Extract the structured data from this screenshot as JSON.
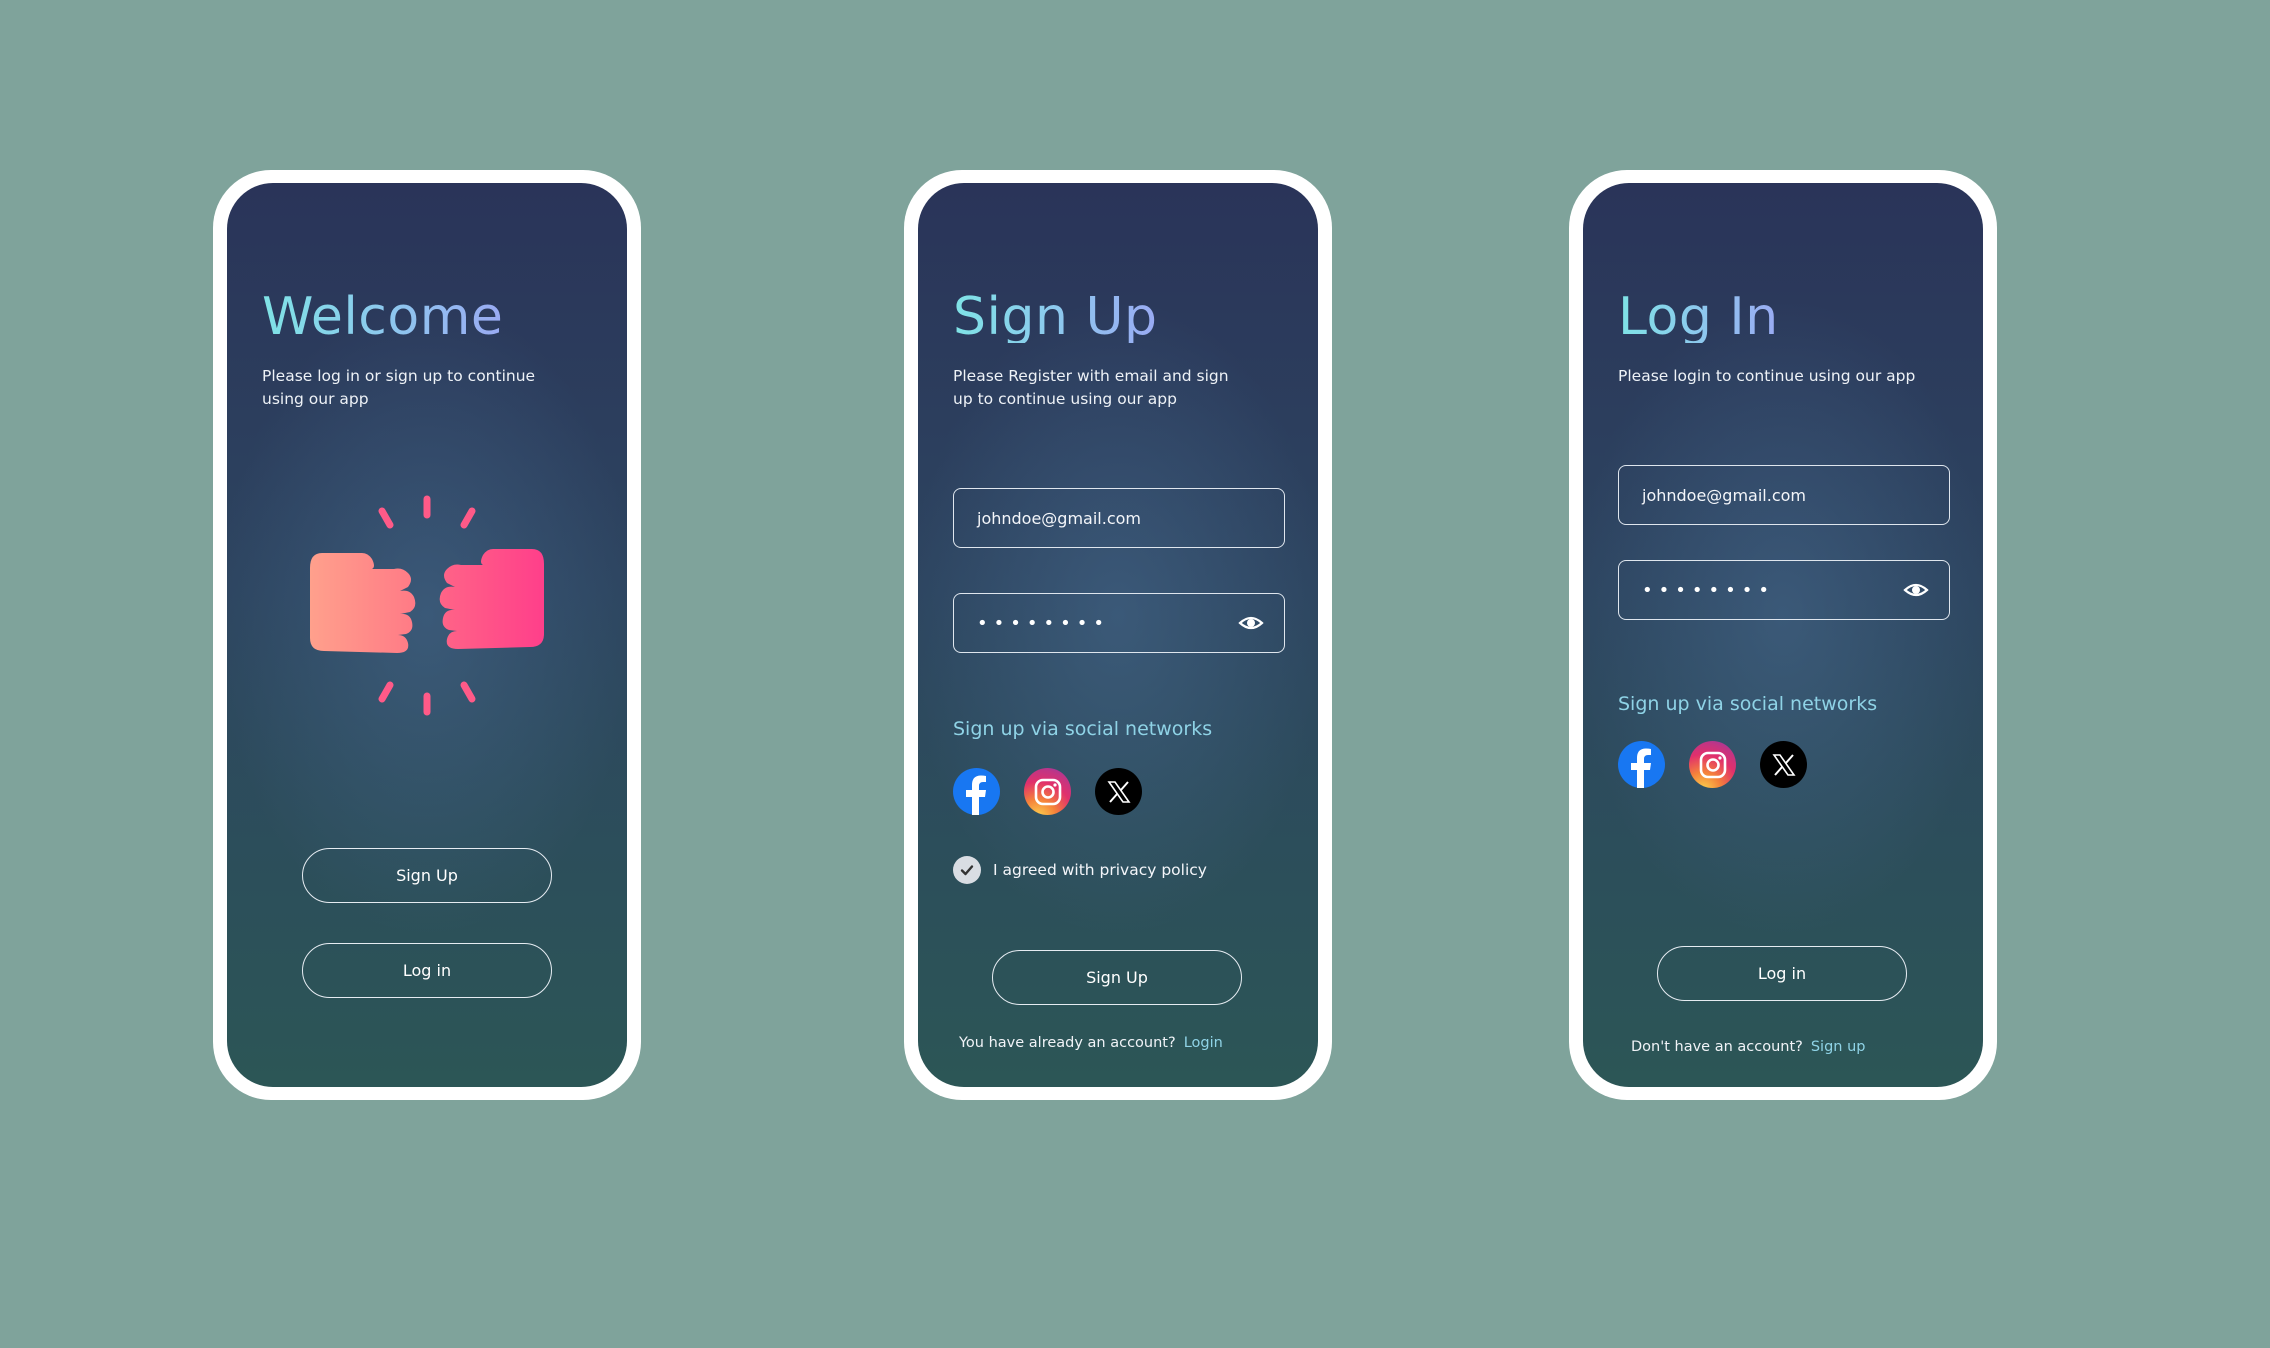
{
  "welcome": {
    "title": "Welcome",
    "subtitle": "Please log in or sign up to continue using our app",
    "illustration_icon": "fist-bump-icon",
    "signup_button": "Sign Up",
    "login_button": "Log in"
  },
  "signup": {
    "title": "Sign Up",
    "subtitle": "Please Register with email and sign up to continue using our app",
    "email_value": "johndoe@gmail.com",
    "password_mask": "••••••••",
    "password_icon": "eye-icon",
    "social_title": "Sign up via social networks",
    "social_icons": [
      "facebook-icon",
      "instagram-icon",
      "x-icon"
    ],
    "privacy_label": "I agreed with privacy policy",
    "privacy_checked": true,
    "submit_button": "Sign Up",
    "footer_text": "You have already an account?",
    "footer_link": "Login"
  },
  "login": {
    "title": "Log In",
    "subtitle": "Please login to continue using our app",
    "email_value": "johndoe@gmail.com",
    "password_mask": "••••••••",
    "password_icon": "eye-icon",
    "social_title": "Sign up via social networks",
    "social_icons": [
      "facebook-icon",
      "instagram-icon",
      "x-icon"
    ],
    "submit_button": "Log in",
    "footer_text": "Don't have an account?",
    "footer_link": "Sign up"
  },
  "colors": {
    "page_background": "#7fa39b",
    "screen_top": "#2a3459",
    "screen_bottom": "#2c5656",
    "accent": "#8fd3e6",
    "fist_left": "#ff9a8a",
    "fist_right": "#ff4d8a"
  }
}
